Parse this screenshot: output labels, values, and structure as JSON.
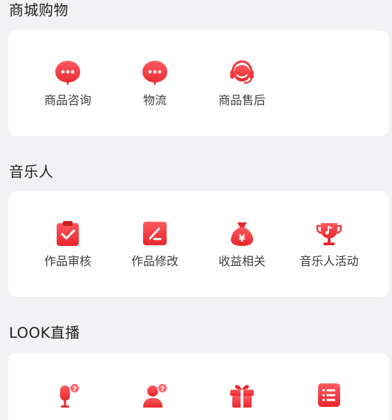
{
  "sections": [
    {
      "title": "商城购物",
      "items": [
        {
          "label": "商品咨询",
          "icon": "chat-bubble-icon"
        },
        {
          "label": "物流",
          "icon": "chat-bubble-icon"
        },
        {
          "label": "商品售后",
          "icon": "headset-icon"
        }
      ]
    },
    {
      "title": "音乐人",
      "items": [
        {
          "label": "作品审核",
          "icon": "clipboard-check-icon"
        },
        {
          "label": "作品修改",
          "icon": "edit-icon"
        },
        {
          "label": "收益相关",
          "icon": "money-bag-icon"
        },
        {
          "label": "音乐人活动",
          "icon": "trophy-icon"
        }
      ]
    },
    {
      "title": "LOOK直播",
      "items": [
        {
          "label": "",
          "icon": "microphone-question-icon"
        },
        {
          "label": "",
          "icon": "user-question-icon"
        },
        {
          "label": "",
          "icon": "gift-icon"
        },
        {
          "label": "",
          "icon": "list-icon"
        }
      ]
    }
  ],
  "colors": {
    "accent": "#f0383d",
    "accent_light": "#ff6b6e",
    "background": "#f2f2f4",
    "card": "#ffffff"
  }
}
